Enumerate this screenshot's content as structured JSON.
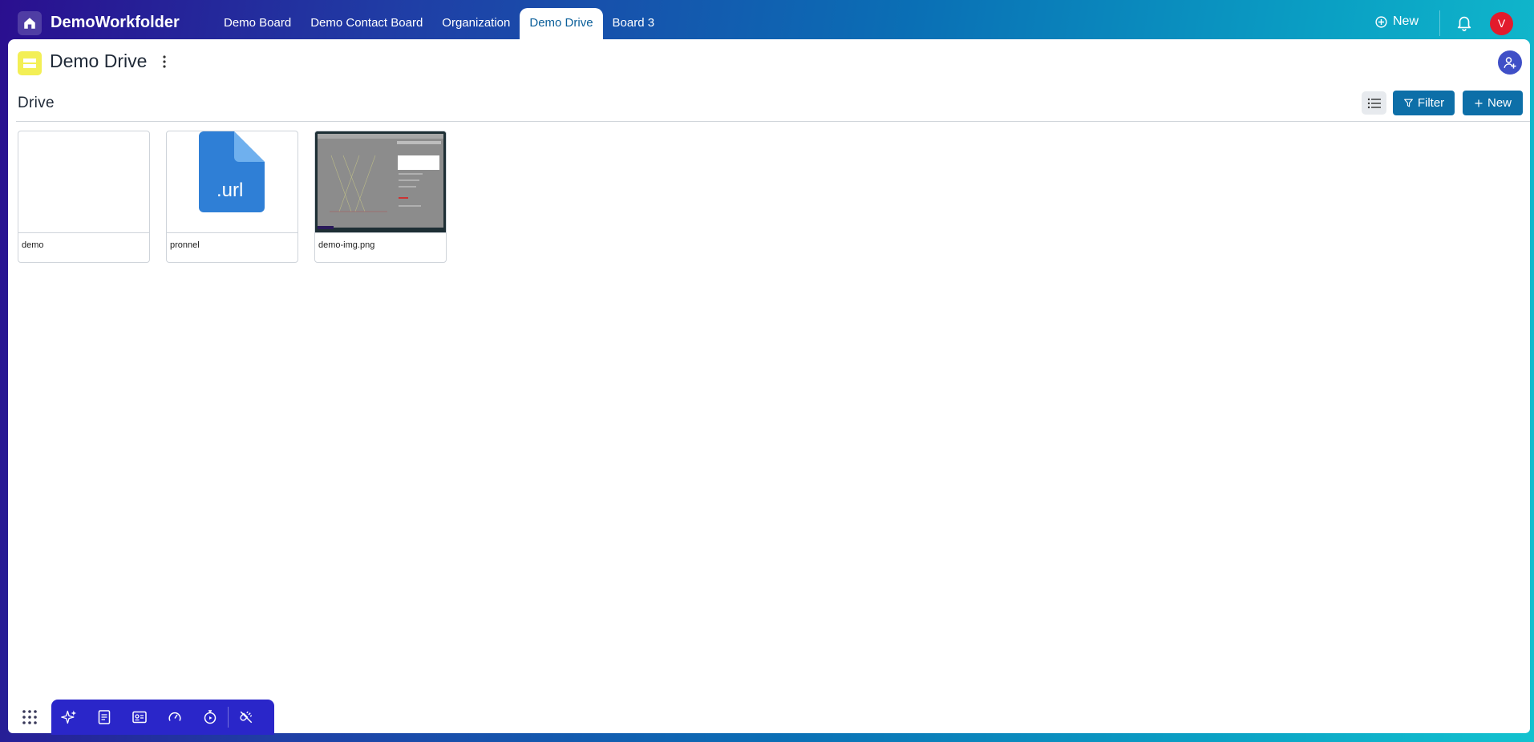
{
  "app": {
    "name": "DemoWorkfolder",
    "user_initial": "V"
  },
  "tabs": [
    {
      "label": "Demo Board",
      "active": false
    },
    {
      "label": "Demo Contact Board",
      "active": false
    },
    {
      "label": "Organization",
      "active": false
    },
    {
      "label": "Demo Drive",
      "active": true
    },
    {
      "label": "Board 3",
      "active": false
    }
  ],
  "topbar": {
    "new_label": "New"
  },
  "board": {
    "title": "Demo Drive"
  },
  "drive": {
    "section_title": "Drive",
    "filter_label": "Filter",
    "new_label": "New",
    "files": [
      {
        "name": "demo",
        "kind": "blank"
      },
      {
        "name": "pronnel",
        "kind": "url",
        "badge": ".url"
      },
      {
        "name": "demo-img.png",
        "kind": "image"
      }
    ]
  },
  "colors": {
    "accent": "#0d6fa8",
    "board_icon": "#f3ef55",
    "avatar": "#e21b2c",
    "dock": "#2a26c9",
    "url_file": "#2f7fd6"
  },
  "icons": {
    "home": "home-icon",
    "plus_circle": "plus-circle-icon",
    "bell": "bell-icon",
    "kebab": "kebab-menu-icon",
    "add_user": "add-user-icon",
    "list": "list-view-icon",
    "filter": "filter-icon",
    "plus": "plus-icon",
    "apps": "apps-grid-icon"
  }
}
